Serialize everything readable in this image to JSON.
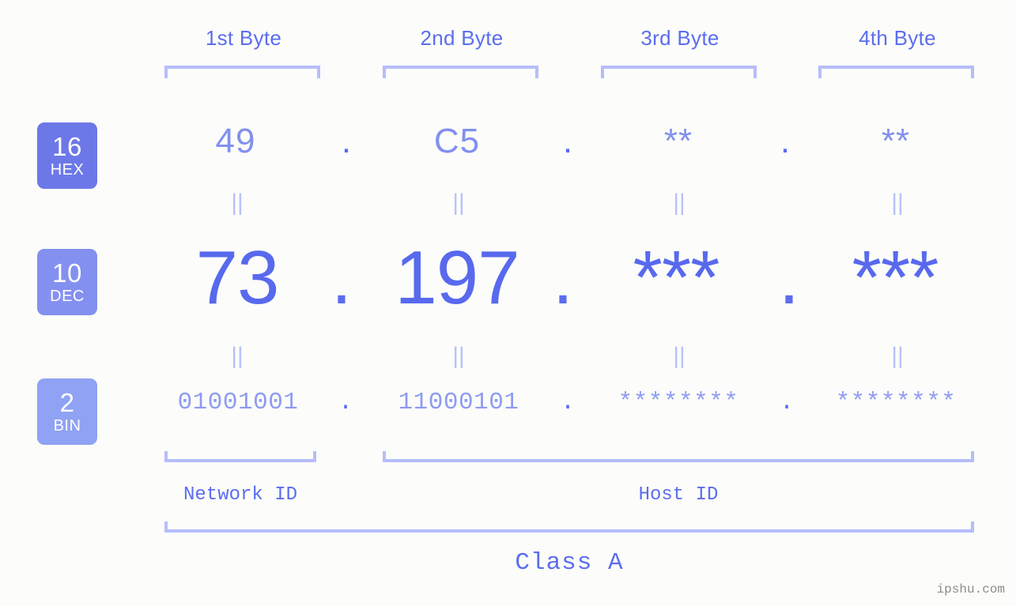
{
  "background": "#fcfdfa",
  "accent": "#5b6df0",
  "accent_light": "#b6bdfb",
  "watermark": "ipshu.com",
  "byte_headers": [
    {
      "label": "1st Byte"
    },
    {
      "label": "2nd Byte"
    },
    {
      "label": "3rd Byte"
    },
    {
      "label": "4th Byte"
    }
  ],
  "bases": [
    {
      "num": "16",
      "name": "HEX",
      "color": "#6d78e8"
    },
    {
      "num": "10",
      "name": "DEC",
      "color": "#8490f0"
    },
    {
      "num": "2",
      "name": "BIN",
      "color": "#8fa2f4"
    }
  ],
  "separator": ".",
  "equals": "||",
  "rows": {
    "hex": {
      "base": "16",
      "base_name": "HEX",
      "values": [
        "49",
        "C5",
        "**",
        "**"
      ]
    },
    "dec": {
      "base": "10",
      "base_name": "DEC",
      "values": [
        "73",
        "197",
        "***",
        "***"
      ]
    },
    "bin": {
      "base": "2",
      "base_name": "BIN",
      "values": [
        "01001001",
        "11000101",
        "********",
        "********"
      ]
    }
  },
  "segments": {
    "network_id": "Network ID",
    "host_id": "Host ID"
  },
  "class": "Class A",
  "chart_data": {
    "type": "table",
    "title": "IP address byte breakdown",
    "columns": [
      "1st Byte",
      "2nd Byte",
      "3rd Byte",
      "4th Byte"
    ],
    "rows": [
      {
        "base": 16,
        "base_name": "HEX",
        "cells": [
          "49",
          "C5",
          "**",
          "**"
        ]
      },
      {
        "base": 10,
        "base_name": "DEC",
        "cells": [
          "73",
          "197",
          "***",
          "***"
        ]
      },
      {
        "base": 2,
        "base_name": "BIN",
        "cells": [
          "01001001",
          "11000101",
          "********",
          "********"
        ]
      }
    ],
    "annotations": {
      "network_id_bytes": [
        1
      ],
      "host_id_bytes": [
        2,
        3,
        4
      ],
      "class": "Class A"
    }
  }
}
